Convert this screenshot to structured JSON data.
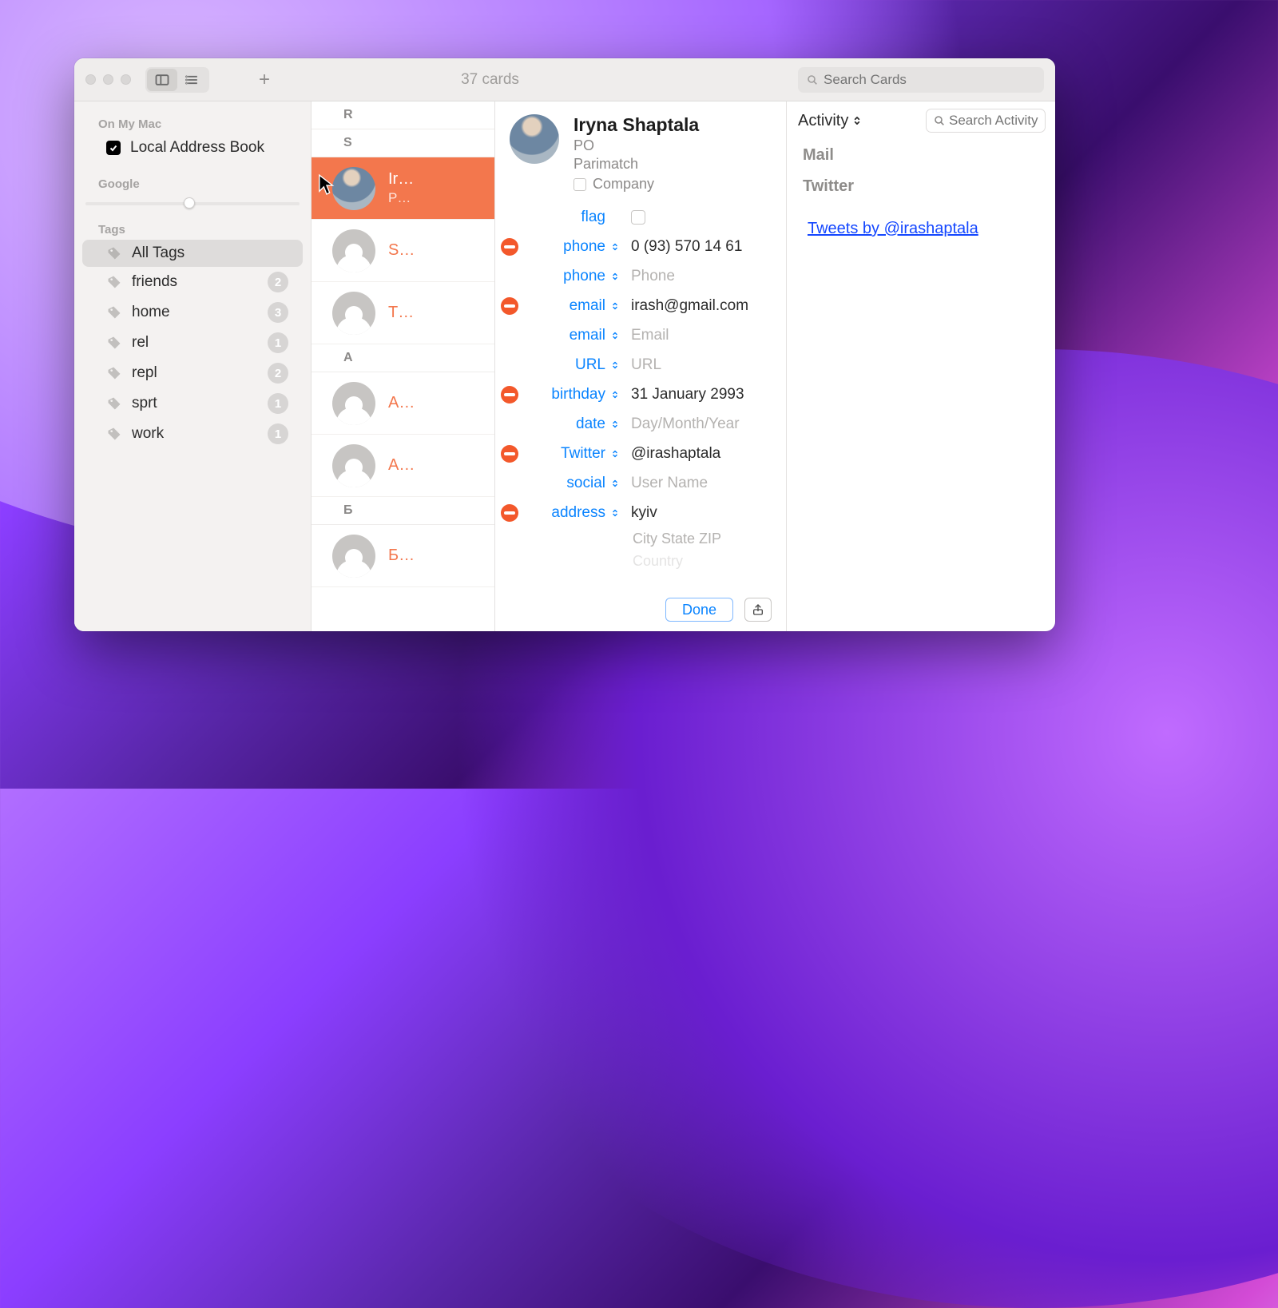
{
  "toolbar": {
    "title": "37 cards",
    "search_placeholder": "Search Cards"
  },
  "sidebar": {
    "accounts_header": "On My Mac",
    "local_label": "Local Address Book",
    "google_header": "Google",
    "tags_header": "Tags",
    "all_tags_label": "All Tags",
    "tags": [
      {
        "name": "friends",
        "count": "2"
      },
      {
        "name": "home",
        "count": "3"
      },
      {
        "name": "rel",
        "count": "1"
      },
      {
        "name": "repl",
        "count": "2"
      },
      {
        "name": "sprt",
        "count": "1"
      },
      {
        "name": "work",
        "count": "1"
      }
    ]
  },
  "list": {
    "sections": [
      {
        "letter": "R",
        "items": []
      },
      {
        "letter": "S",
        "items": [
          {
            "name": "Ir…",
            "sub": "P…",
            "photo": true,
            "selected": true
          },
          {
            "name": "S…",
            "sub": "",
            "photo": false,
            "selected": false
          },
          {
            "name": "T…",
            "sub": "",
            "photo": false,
            "selected": false
          }
        ]
      },
      {
        "letter": "A",
        "items": [
          {
            "name": "A…",
            "sub": "",
            "photo": false,
            "selected": false
          },
          {
            "name": "A…",
            "sub": "",
            "photo": false,
            "selected": false
          }
        ]
      },
      {
        "letter": "Б",
        "items": [
          {
            "name": "Б…",
            "sub": "",
            "photo": false,
            "selected": false
          }
        ]
      }
    ]
  },
  "card": {
    "name": "Iryna Shaptala",
    "role": "PO",
    "company": "Parimatch",
    "company_label": "Company",
    "flag_label": "flag",
    "fields": {
      "phone_label": "phone",
      "phone_value": "0 (93) 570 14 61",
      "phone2_placeholder": "Phone",
      "email_label": "email",
      "email_value": "irash@gmail.com",
      "email2_placeholder": "Email",
      "url_label": "URL",
      "url_placeholder": "URL",
      "birthday_label": "birthday",
      "birthday_value": "31 January 2993",
      "date_label": "date",
      "date_placeholder": "Day/Month/Year",
      "twitter_label": "Twitter",
      "twitter_value": "@irashaptala",
      "social_label": "social",
      "social_placeholder": "User Name",
      "address_label": "address",
      "address_value": "kyiv",
      "address_city_zip": "City  State  ZIP",
      "address_country": "Country"
    },
    "done_label": "Done"
  },
  "activity": {
    "title": "Activity",
    "search_placeholder": "Search Activity",
    "mail_header": "Mail",
    "twitter_header": "Twitter",
    "tweets_link": "Tweets by @irashaptala"
  }
}
